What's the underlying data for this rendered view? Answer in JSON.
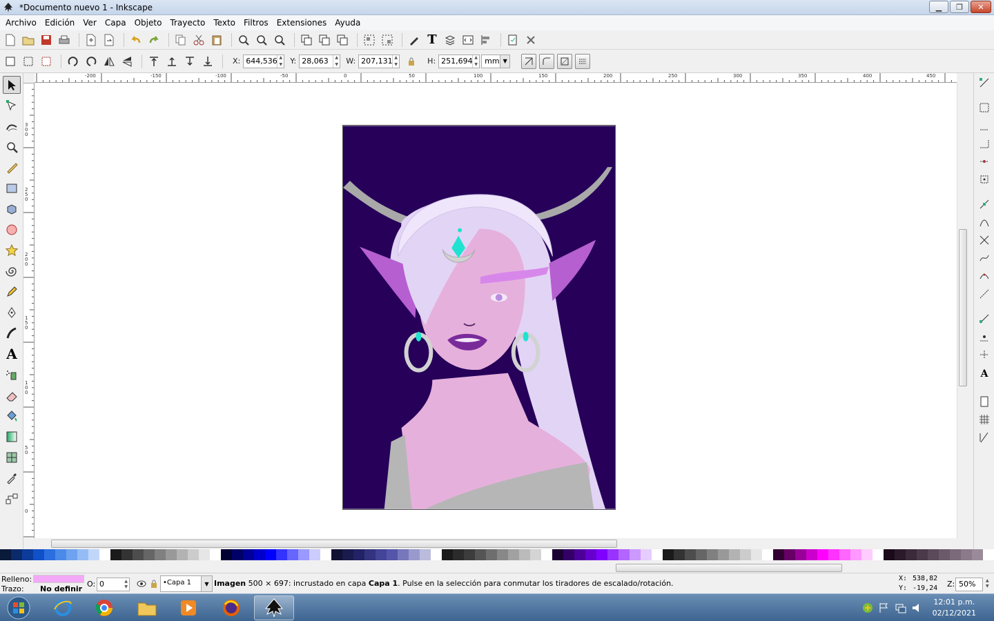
{
  "window": {
    "title": "*Documento nuevo 1 - Inkscape"
  },
  "menu": [
    "Archivo",
    "Edición",
    "Ver",
    "Capa",
    "Objeto",
    "Trayecto",
    "Texto",
    "Filtros",
    "Extensiones",
    "Ayuda"
  ],
  "selector": {
    "x_label": "X:",
    "x_value": "644,536",
    "y_label": "Y:",
    "y_value": "28,063",
    "w_label": "W:",
    "w_value": "207,131",
    "h_label": "H:",
    "h_value": "251,694",
    "unit": "mm"
  },
  "rulers": {
    "top": [
      "-200",
      "-150",
      "-100",
      "-50",
      "0",
      "50",
      "100",
      "150",
      "200",
      "250",
      "300",
      "350",
      "400",
      "450"
    ],
    "left": [
      "3\n0\n0",
      "2\n5\n0",
      "2\n0\n0",
      "1\n5\n0",
      "1\n0\n0",
      "5\n0",
      "0"
    ]
  },
  "status": {
    "fill_label": "Relleno:",
    "stroke_label": "Trazo:",
    "stroke_value": "No definir",
    "opacity_label": "O:",
    "opacity_value": "0",
    "layer": "•Capa 1",
    "message_bold": "Imagen",
    "message": " 500 × 697: incrustado en capa ",
    "message_layer": "Capa 1",
    "message_tail": ". Pulse en la selección para conmutar los tiradores de escalado/rotación.",
    "coord_x_label": "X:",
    "coord_x": "538,82",
    "coord_y_label": "Y:",
    "coord_y": "-19,24",
    "zoom_label": "Z:",
    "zoom_value": "50%"
  },
  "taskbar": {
    "time": "12:01 p.m.",
    "date": "02/12/2021"
  },
  "colors": {
    "artwork_bg": "#260059",
    "skin": "#e6b0dc",
    "hair": "#e2d4f5",
    "horns": "#a9a9a9",
    "ears": "#b65fd0",
    "gems": "#1fe3d0",
    "lips": "#7a2b9a",
    "fill_swatch": "#f3a9f7"
  }
}
